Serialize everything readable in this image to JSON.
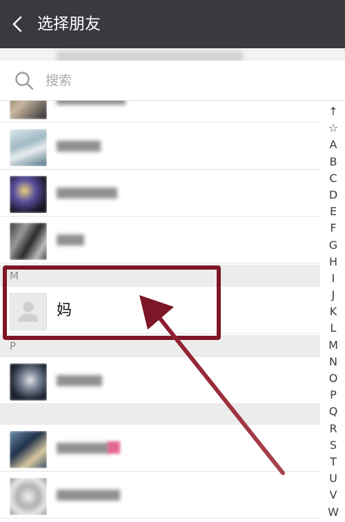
{
  "header": {
    "title": "选择朋友",
    "back_icon": "chevron-left-icon"
  },
  "search": {
    "placeholder": "搜索",
    "icon": "search-icon"
  },
  "sections": {
    "m": "M",
    "p": "P"
  },
  "contacts": {
    "mom": "妈"
  },
  "alpha_index": [
    "↑",
    "☆",
    "A",
    "B",
    "C",
    "D",
    "E",
    "F",
    "G",
    "H",
    "I",
    "J",
    "K",
    "L",
    "M",
    "N",
    "O",
    "P",
    "Q",
    "R",
    "S",
    "T",
    "U",
    "V",
    "W"
  ],
  "colors": {
    "topbar": "#393a3f",
    "highlight": "#7d1626",
    "section_bg": "#ececec"
  }
}
